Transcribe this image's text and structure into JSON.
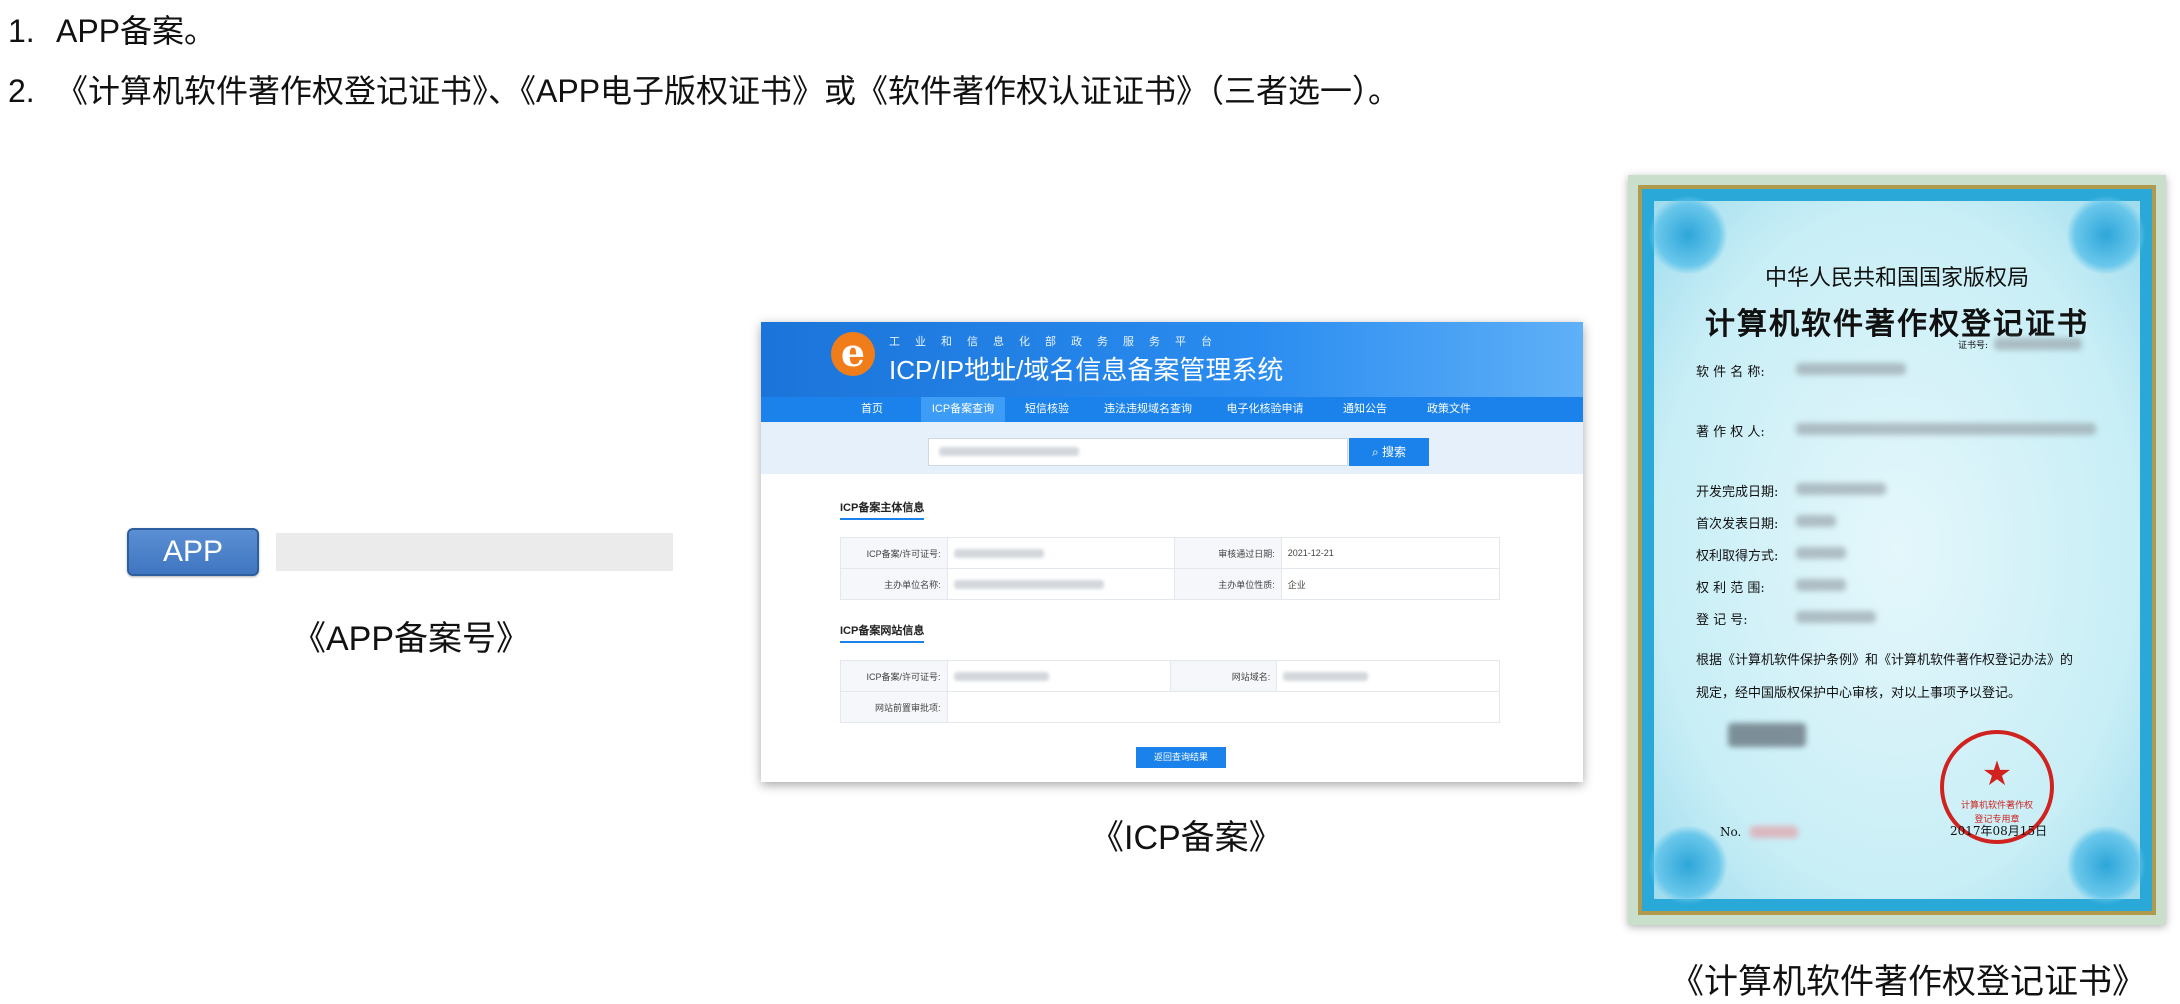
{
  "list": {
    "item1": {
      "num": "1.",
      "text": "APP备案。"
    },
    "item2": {
      "num": "2.",
      "text": "《计算机软件著作权登记证书》、《APP电子版权证书》或《软件著作权认证证书》（三者选一）。"
    }
  },
  "app_block": {
    "badge": "APP",
    "caption": "《APP备案号》"
  },
  "icp": {
    "caption": "《ICP备案》",
    "subtitle": "工业和信息化部政务服务平台",
    "title": "ICP/IP地址/域名信息备案管理系统",
    "logo": "e",
    "nav": [
      "首页",
      "ICP备案查询",
      "短信核验",
      "违法违规域名查询",
      "电子化核验申请",
      "通知公告",
      "政策文件"
    ],
    "search_button": "搜索",
    "section1": "ICP备案主体信息",
    "section2": "ICP备案网站信息",
    "rows1": [
      {
        "k1": "ICP备案/许可证号:",
        "k2": "审核通过日期:",
        "v2": "2021-12-21"
      },
      {
        "k1": "主办单位名称:",
        "k2": "主办单位性质:",
        "v2": "企业"
      }
    ],
    "rows2": [
      {
        "k1": "ICP备案/许可证号:",
        "k2": "网站域名:"
      },
      {
        "k1": "网站前置审批项:"
      }
    ],
    "back_button": "返回查询结果"
  },
  "cert": {
    "caption": "《计算机软件著作权登记证书》",
    "agency": "中华人民共和国国家版权局",
    "title": "计算机软件著作权登记证书",
    "cert_no_label": "证书号:",
    "fields": [
      "软 件 名 称:",
      "著 作 权 人:",
      "开发完成日期:",
      "首次发表日期:",
      "权利取得方式:",
      "权 利 范 围:",
      "登    记    号:"
    ],
    "body1": "根据《计算机软件保护条例》和《计算机软件著作权登记办法》的",
    "body2": "规定，经中国版权保护中心审核，对以上事项予以登记。",
    "seal_line1": "计算机软件著作权",
    "seal_line2": "登记专用章",
    "date": "2017年08月15日",
    "no_label": "No."
  },
  "colors": {
    "nav_blue": "#1a82ea",
    "seal_red": "#d0231f",
    "app_badge": "#4a82c8"
  }
}
